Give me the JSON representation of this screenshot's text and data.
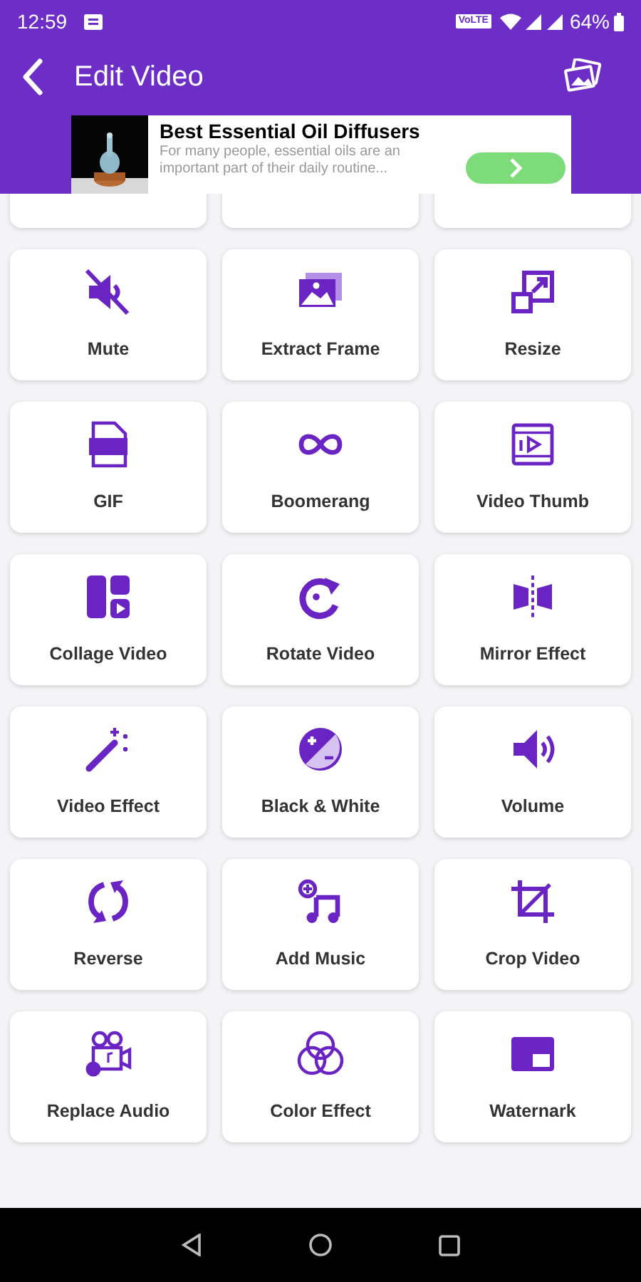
{
  "status_bar": {
    "time": "12:59",
    "network": "VoLTE",
    "battery": "64%"
  },
  "app_bar": {
    "title": "Edit Video"
  },
  "ad": {
    "title": "Best Essential Oil Diffusers",
    "body": "For many people, essential oils are an important part of their daily routine..."
  },
  "tools": [
    {
      "label": "Mute"
    },
    {
      "label": "Extract Frame"
    },
    {
      "label": "Resize"
    },
    {
      "label": "GIF"
    },
    {
      "label": "Boomerang"
    },
    {
      "label": "Video Thumb"
    },
    {
      "label": "Collage Video"
    },
    {
      "label": "Rotate Video"
    },
    {
      "label": "Mirror Effect"
    },
    {
      "label": "Video Effect"
    },
    {
      "label": "Black & White"
    },
    {
      "label": "Volume"
    },
    {
      "label": "Reverse"
    },
    {
      "label": "Add Music"
    },
    {
      "label": "Crop Video"
    },
    {
      "label": "Replace Audio"
    },
    {
      "label": "Color Effect"
    },
    {
      "label": "Waternark"
    }
  ]
}
